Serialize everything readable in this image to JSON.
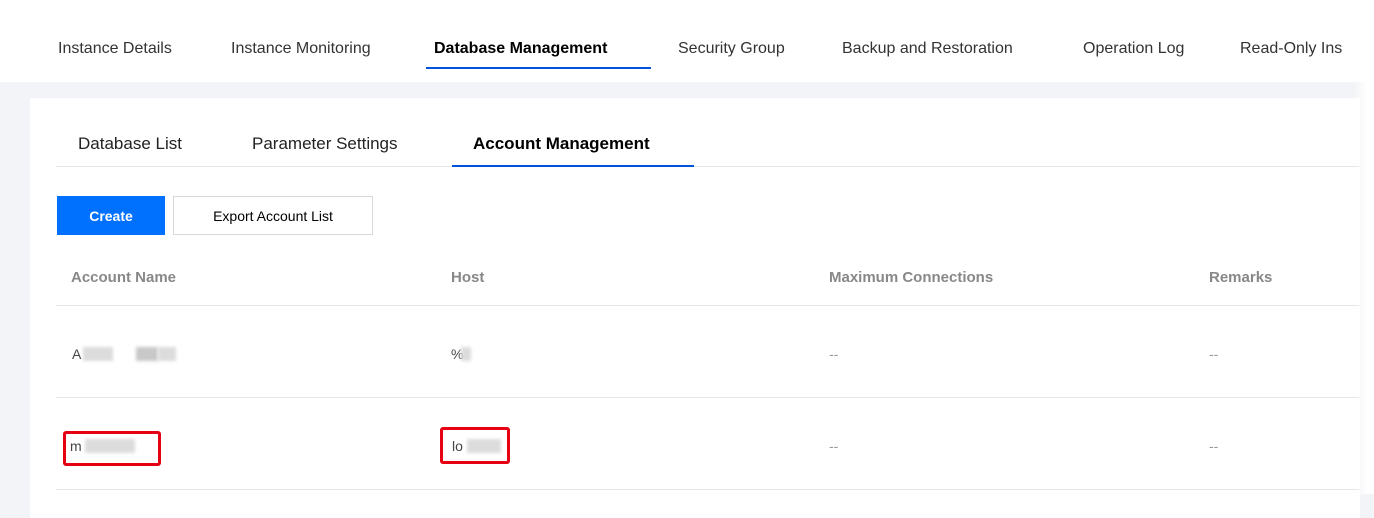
{
  "top_tabs": [
    {
      "label": "Instance Details",
      "active": false
    },
    {
      "label": "Instance Monitoring",
      "active": false
    },
    {
      "label": "Database Management",
      "active": true
    },
    {
      "label": "Security Group",
      "active": false
    },
    {
      "label": "Backup and Restoration",
      "active": false
    },
    {
      "label": "Operation Log",
      "active": false
    },
    {
      "label": "Read-Only Ins",
      "active": false
    }
  ],
  "sub_tabs": [
    {
      "label": "Database List",
      "active": false
    },
    {
      "label": "Parameter Settings",
      "active": false
    },
    {
      "label": "Account Management",
      "active": true
    }
  ],
  "buttons": {
    "create": "Create",
    "export": "Export Account List"
  },
  "table": {
    "columns": [
      "Account Name",
      "Host",
      "Maximum Connections",
      "Remarks"
    ],
    "rows": [
      {
        "account": "A",
        "host": "%",
        "max_connections": "--",
        "remarks": "--"
      },
      {
        "account": "m",
        "host": "lo",
        "max_connections": "--",
        "remarks": "--"
      }
    ]
  },
  "colors": {
    "accent": "#0052d9",
    "primary_button": "#0070ff",
    "highlight_box": "#e60012"
  }
}
